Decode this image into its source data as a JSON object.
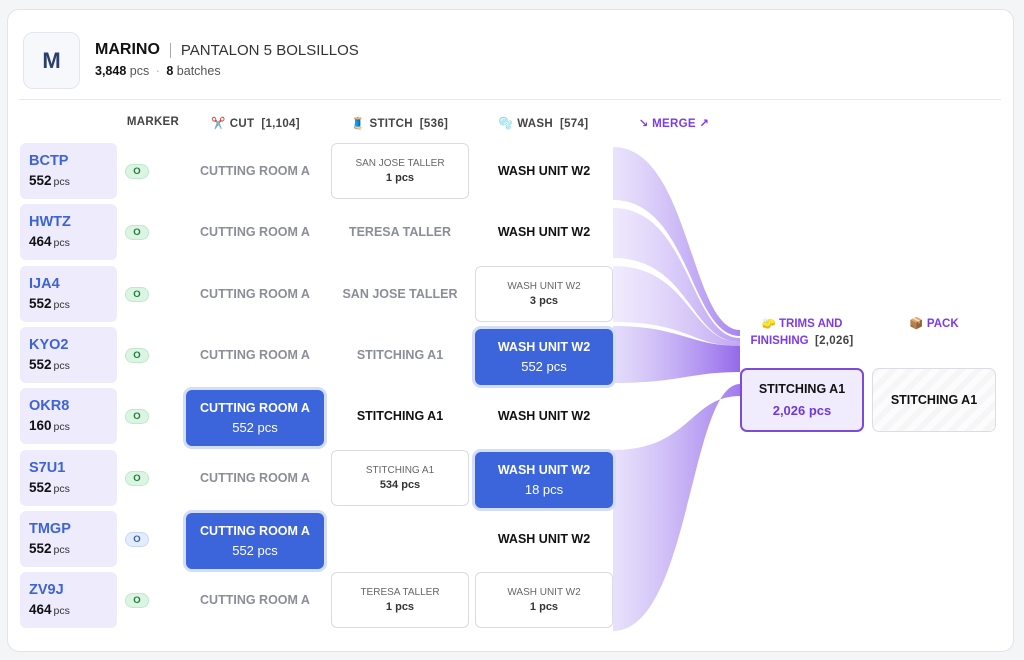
{
  "header": {
    "avatar_letter": "M",
    "title": "MARINO",
    "subtitle": "PANTALON 5 BOLSILLOS",
    "total_pcs": "3,848",
    "pcs_unit": "pcs",
    "separator": "·",
    "batches_count": "8",
    "batches_label": "batches"
  },
  "columns": {
    "marker": "MARKER",
    "cut_icon": "✂️",
    "cut": "CUT",
    "cut_count": "[1,104]",
    "stitch_icon": "🧵",
    "stitch": "STITCH",
    "stitch_count": "[536]",
    "wash_icon": "🫧",
    "wash": "WASH",
    "wash_count": "[574]",
    "merge": "↘ MERGE ↗"
  },
  "rows": [
    {
      "code": "BCTP",
      "qty": "552",
      "unit": "pcs",
      "marker": "O",
      "cut": {
        "name": "CUTTING ROOM A"
      },
      "stitch": {
        "name": "SAN JOSE TALLER",
        "qty": "1 pcs"
      },
      "wash": {
        "name": "WASH UNIT W2"
      }
    },
    {
      "code": "HWTZ",
      "qty": "464",
      "unit": "pcs",
      "marker": "O",
      "cut": {
        "name": "CUTTING ROOM A"
      },
      "stitch": {
        "name": "TERESA TALLER"
      },
      "wash": {
        "name": "WASH UNIT W2"
      }
    },
    {
      "code": "IJA4",
      "qty": "552",
      "unit": "pcs",
      "marker": "O",
      "cut": {
        "name": "CUTTING ROOM A"
      },
      "stitch": {
        "name": "SAN JOSE TALLER"
      },
      "wash": {
        "name": "WASH UNIT W2",
        "qty": "3 pcs"
      }
    },
    {
      "code": "KYO2",
      "qty": "552",
      "unit": "pcs",
      "marker": "O",
      "cut": {
        "name": "CUTTING ROOM A"
      },
      "stitch": {
        "name": "STITCHING A1"
      },
      "wash": {
        "name": "WASH UNIT W2",
        "qty": "552 pcs"
      }
    },
    {
      "code": "OKR8",
      "qty": "160",
      "unit": "pcs",
      "marker": "O",
      "cut": {
        "name": "CUTTING ROOM A",
        "qty": "552 pcs"
      },
      "stitch": {
        "name": "STITCHING A1"
      },
      "wash": {
        "name": "WASH UNIT W2"
      }
    },
    {
      "code": "S7U1",
      "qty": "552",
      "unit": "pcs",
      "marker": "O",
      "cut": {
        "name": "CUTTING ROOM A"
      },
      "stitch": {
        "name": "STITCHING A1",
        "qty": "534 pcs"
      },
      "wash": {
        "name": "WASH UNIT W2",
        "qty": "18 pcs"
      }
    },
    {
      "code": "TMGP",
      "qty": "552",
      "unit": "pcs",
      "marker": "O",
      "cut": {
        "name": "CUTTING ROOM A",
        "qty": "552 pcs"
      },
      "stitch": {
        "name": ""
      },
      "wash": {
        "name": "WASH UNIT W2"
      }
    },
    {
      "code": "ZV9J",
      "qty": "464",
      "unit": "pcs",
      "marker": "O",
      "cut": {
        "name": "CUTTING ROOM A"
      },
      "stitch": {
        "name": "TERESA TALLER",
        "qty": "1 pcs"
      },
      "wash": {
        "name": "WASH UNIT W2",
        "qty": "1 pcs"
      }
    }
  ],
  "trims": {
    "icon": "🧽",
    "label_line1": "TRIMS AND",
    "label_line2": "FINISHING",
    "count": "[2,026]",
    "box_name": "STITCHING A1",
    "box_qty": "2,026 pcs"
  },
  "pack": {
    "icon": "📦",
    "label": "PACK",
    "box_name": "STITCHING A1"
  },
  "colors": {
    "accent_blue": "#3c64db",
    "accent_purple": "#7c3aed",
    "lot_bg": "#eeebfd",
    "marker_green": "#dcf5e3",
    "marker_blue": "#e3ecfb"
  }
}
